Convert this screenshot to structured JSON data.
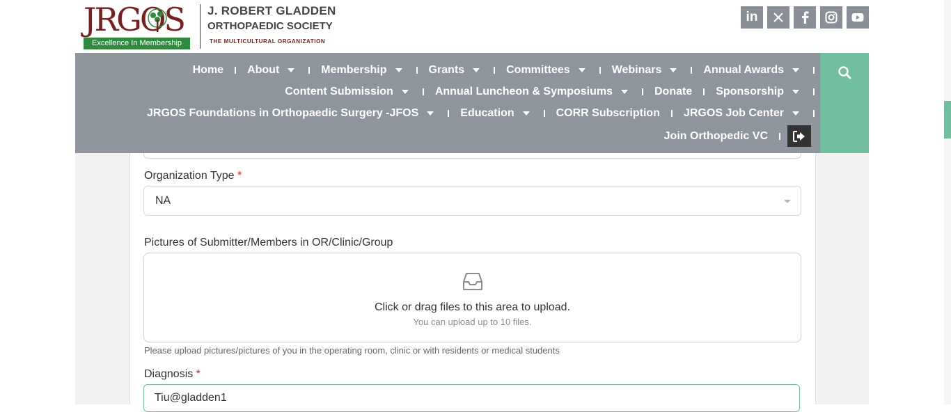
{
  "header": {
    "logo_text": "JRGOS",
    "logo_badge": "Excellence In Membership",
    "org_name_line1": "J. ROBERT GLADDEN",
    "org_name_line2": "ORTHOPAEDIC SOCIETY",
    "tagline": "THE MULTICULTURAL ORGANIZATION"
  },
  "social": {
    "icons": [
      "linkedin-icon",
      "x-icon",
      "facebook-icon",
      "instagram-icon",
      "youtube-icon"
    ],
    "linkedin_glyph": "in"
  },
  "nav": {
    "row1": [
      "Home",
      "About",
      "Membership",
      "Grants",
      "Committees",
      "Webinars",
      "Annual Awards"
    ],
    "row2": [
      "Content Submission",
      "Annual Luncheon & Symposiums",
      "Donate",
      "Sponsorship"
    ],
    "row3": [
      "JRGOS Foundations in Orthopaedic Surgery -JFOS",
      "Education",
      "CORR Subscription",
      "JRGOS Job Center"
    ],
    "row4": [
      "Join Orthopedic VC"
    ]
  },
  "form": {
    "org_type": {
      "label": "Organization Type",
      "required_mark": "*",
      "value": "NA"
    },
    "pictures": {
      "label": "Pictures of Submitter/Members in OR/Clinic/Group",
      "upload_title": "Click or drag files to this area to upload.",
      "upload_hint": "You can upload up to 10 files.",
      "help_text": "Please upload pictures/pictures of you in the operating room, clinic or with residents or medical students"
    },
    "diagnosis": {
      "label": "Diagnosis",
      "required_mark": "*",
      "value": "Tiu@gladden1"
    }
  },
  "colors": {
    "nav_bg": "#8f959c",
    "accent_green": "#72bfa0",
    "brand_maroon": "#7a1f1f",
    "badge_green": "#2e8b3d"
  }
}
